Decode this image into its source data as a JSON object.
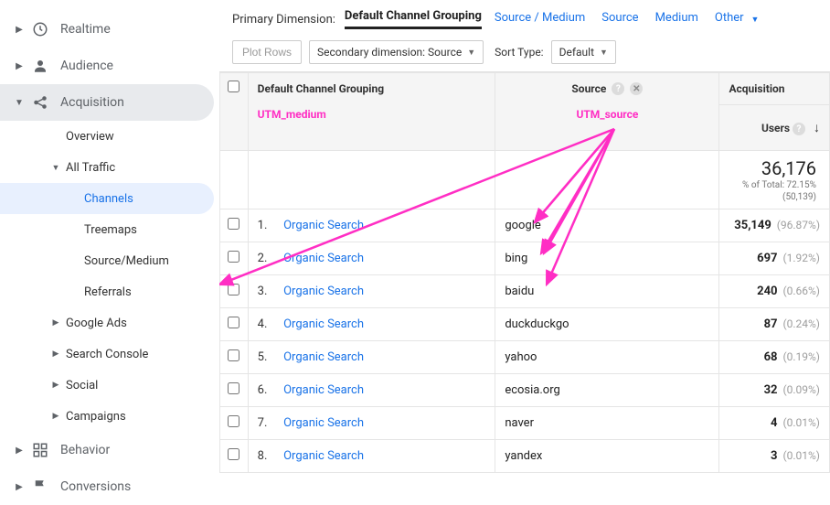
{
  "sidebar": {
    "items": [
      {
        "label": "Realtime",
        "icon": "clock"
      },
      {
        "label": "Audience",
        "icon": "person"
      },
      {
        "label": "Acquisition",
        "icon": "share",
        "expanded": true,
        "children": [
          {
            "label": "Overview"
          },
          {
            "label": "All Traffic",
            "expanded": true,
            "children": [
              {
                "label": "Channels",
                "selected": true
              },
              {
                "label": "Treemaps"
              },
              {
                "label": "Source/Medium"
              },
              {
                "label": "Referrals"
              }
            ]
          },
          {
            "label": "Google Ads",
            "hasCaret": true
          },
          {
            "label": "Search Console",
            "hasCaret": true
          },
          {
            "label": "Social",
            "hasCaret": true
          },
          {
            "label": "Campaigns",
            "hasCaret": true
          }
        ]
      },
      {
        "label": "Behavior",
        "icon": "squares"
      },
      {
        "label": "Conversions",
        "icon": "flag"
      }
    ]
  },
  "dimensionBar": {
    "label": "Primary Dimension:",
    "selected": "Default Channel Grouping",
    "options": [
      "Source / Medium",
      "Source",
      "Medium",
      "Other"
    ]
  },
  "controls": {
    "plotRows": "Plot Rows",
    "secondaryDim": "Secondary dimension: Source",
    "sortLabel": "Sort Type:",
    "sortValue": "Default"
  },
  "table": {
    "headers": {
      "channel": "Default Channel Grouping",
      "channelSub": "UTM_medium",
      "source": "Source",
      "sourceSub": "UTM_source",
      "acquisition": "Acquisition",
      "users": "Users"
    },
    "summary": {
      "users": "36,176",
      "subline1": "% of Total: 72.15%",
      "subline2": "(50,139)"
    },
    "rows": [
      {
        "idx": "1.",
        "channel": "Organic Search",
        "source": "google",
        "users": "35,149",
        "pct": "(96.87%)"
      },
      {
        "idx": "2.",
        "channel": "Organic Search",
        "source": "bing",
        "users": "697",
        "pct": "(1.92%)"
      },
      {
        "idx": "3.",
        "channel": "Organic Search",
        "source": "baidu",
        "users": "240",
        "pct": "(0.66%)"
      },
      {
        "idx": "4.",
        "channel": "Organic Search",
        "source": "duckduckgo",
        "users": "87",
        "pct": "(0.24%)"
      },
      {
        "idx": "5.",
        "channel": "Organic Search",
        "source": "yahoo",
        "users": "68",
        "pct": "(0.19%)"
      },
      {
        "idx": "6.",
        "channel": "Organic Search",
        "source": "ecosia.org",
        "users": "32",
        "pct": "(0.09%)"
      },
      {
        "idx": "7.",
        "channel": "Organic Search",
        "source": "naver",
        "users": "4",
        "pct": "(0.01%)"
      },
      {
        "idx": "8.",
        "channel": "Organic Search",
        "source": "yandex",
        "users": "3",
        "pct": "(0.01%)"
      }
    ]
  }
}
